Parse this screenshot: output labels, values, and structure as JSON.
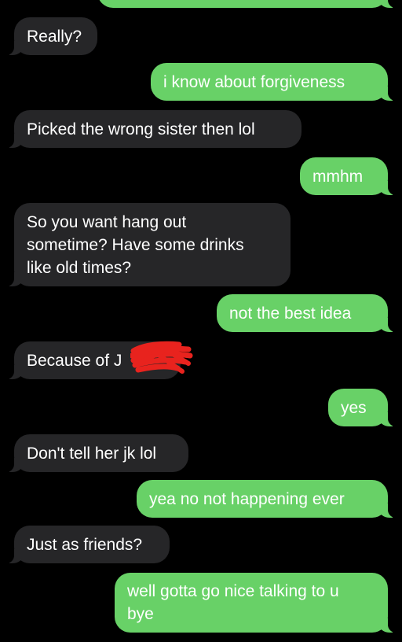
{
  "messages": [
    {
      "from": "sent",
      "text": ""
    },
    {
      "from": "received",
      "text": "Really?"
    },
    {
      "from": "sent",
      "text": "i know about forgiveness"
    },
    {
      "from": "received",
      "text": "Picked the wrong sister then lol"
    },
    {
      "from": "sent",
      "text": "mmhm"
    },
    {
      "from": "received",
      "text": "So you want hang out\nsometime? Have some drinks\nlike old times?"
    },
    {
      "from": "sent",
      "text": "not the best idea"
    },
    {
      "from": "received",
      "text": "Because of J"
    },
    {
      "from": "sent",
      "text": "yes"
    },
    {
      "from": "received",
      "text": "Don't tell her jk lol"
    },
    {
      "from": "sent",
      "text": "yea no not happening ever"
    },
    {
      "from": "received",
      "text": "Just as friends?"
    },
    {
      "from": "sent",
      "text": "well gotta go nice talking to u\nbye"
    }
  ],
  "colors": {
    "background": "#000000",
    "received_bubble": "#262628",
    "sent_bubble": "#68d167",
    "text": "#ffffff",
    "redaction": "#e8231e"
  }
}
